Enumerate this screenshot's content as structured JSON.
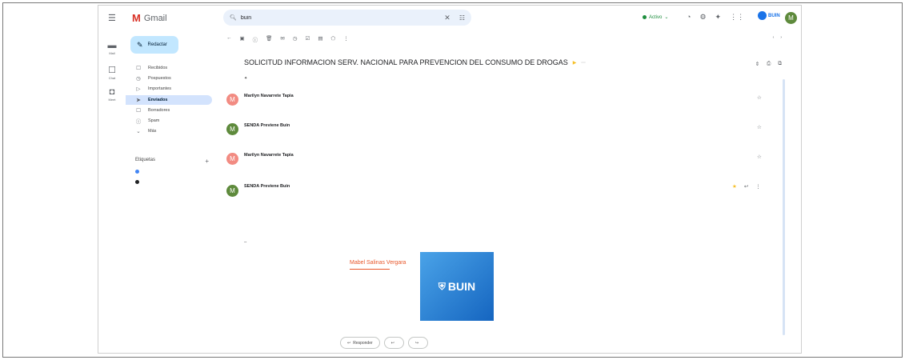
{
  "app": {
    "name": "Gmail",
    "menu_icon": "menu-icon",
    "status": "Activo",
    "top_icons": [
      "help-icon",
      "settings-icon",
      "gemini-icon",
      "apps-icon"
    ],
    "org_logo": "BUIN",
    "avatar_letter": "M"
  },
  "search": {
    "value": "buin",
    "icon": "search-icon"
  },
  "rail": [
    {
      "icon": "mail-icon",
      "label": "Mail"
    },
    {
      "icon": "chat-icon",
      "label": "Chat"
    },
    {
      "icon": "meet-icon",
      "label": "Meet"
    }
  ],
  "compose": {
    "label": "Redactar"
  },
  "nav": [
    {
      "icon": "inbox-icon",
      "glyph": "☐",
      "label": "Recibidos",
      "count": "",
      "active": false
    },
    {
      "icon": "snooze-icon",
      "glyph": "◷",
      "label": "Pospuestos",
      "count": "",
      "active": false
    },
    {
      "icon": "important-icon",
      "glyph": "▷",
      "label": "Importantes",
      "count": "",
      "active": false
    },
    {
      "icon": "sent-icon",
      "glyph": "➤",
      "label": "Enviados",
      "count": "",
      "active": true
    },
    {
      "icon": "drafts-icon",
      "glyph": "☐",
      "label": "Borradores",
      "count": "",
      "active": false
    },
    {
      "icon": "spam-icon",
      "glyph": "ⓘ",
      "label": "Spam",
      "count": "",
      "active": false
    },
    {
      "icon": "chevron-down-icon",
      "glyph": "⌄",
      "label": "Más",
      "count": "",
      "active": false
    }
  ],
  "labels": {
    "title": "Etiquetas",
    "items": [
      {
        "name": "",
        "color": "#4285f4"
      },
      {
        "name": "",
        "color": "#202124"
      }
    ]
  },
  "thread": {
    "subject": "SOLICITUD INFORMACION SERV. NACIONAL PARA PREVENCION DEL CONSUMO DE DROGAS",
    "label": "",
    "summary": "",
    "messages": [
      {
        "sender": "Marilyn Navarrete Tapia",
        "snippet": "",
        "date": "",
        "avatar_color": "#f28b82"
      },
      {
        "sender": "SENDA Previene Buin",
        "snippet": "",
        "date": "",
        "avatar_color": "#5e8a3c"
      },
      {
        "sender": "Marilyn Navarrete Tapia",
        "snippet": "",
        "date": "",
        "avatar_color": "#f28b82"
      }
    ],
    "open_message": {
      "sender": "SENDA Previene Buin",
      "to": "",
      "date": "",
      "avatar_color": "#5e8a3c",
      "body": [
        "",
        "",
        ""
      ]
    }
  },
  "signature": {
    "name": "Mabel Salinas Vergara",
    "logo_text": "BUIN"
  },
  "reply_buttons": [
    {
      "label": "Responder",
      "icon": "reply-icon"
    },
    {
      "label": "",
      "icon": "reply-all-icon"
    },
    {
      "label": "",
      "icon": "forward-icon"
    }
  ]
}
